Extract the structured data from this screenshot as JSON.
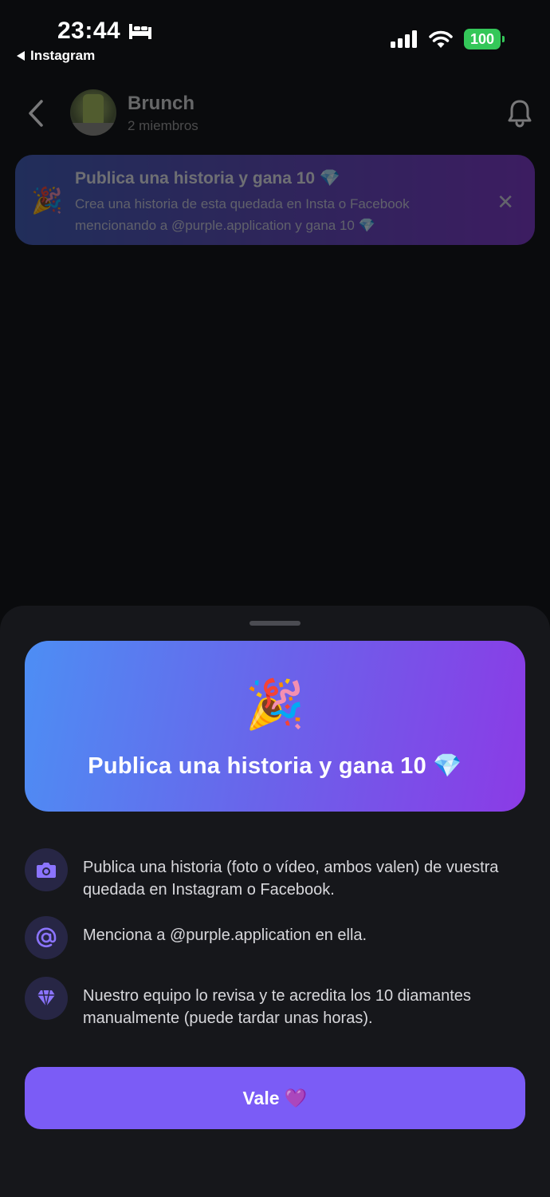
{
  "status_bar": {
    "time": "23:44",
    "back_app": "Instagram",
    "battery": "100"
  },
  "header": {
    "group_name": "Brunch",
    "members": "2 miembros"
  },
  "banner": {
    "emoji": "🎉",
    "title": "Publica una historia y gana 10 💎",
    "text": "Crea una historia de esta quedada en Insta o Facebook mencionando a @purple.application y gana 10 💎",
    "close": "✕"
  },
  "sheet": {
    "hero_emoji": "🎉",
    "hero_title": "Publica una historia y gana 10 💎",
    "steps": [
      {
        "icon": "camera-icon",
        "text": "Publica una historia (foto o vídeo, ambos valen) de vuestra quedada en Instagram o Facebook."
      },
      {
        "icon": "at-icon",
        "text": "Menciona a @purple.application en ella."
      },
      {
        "icon": "diamond-icon",
        "text": "Nuestro equipo lo revisa y te acredita los 10 diamantes manualmente (puede tardar unas horas)."
      }
    ],
    "button_label": "Vale 💜"
  },
  "colors": {
    "background": "#0a0b0d",
    "sheet": "#16171b",
    "accent": "#7b5cf6",
    "step_icon_bg": "#272645",
    "battery": "#34c759"
  }
}
